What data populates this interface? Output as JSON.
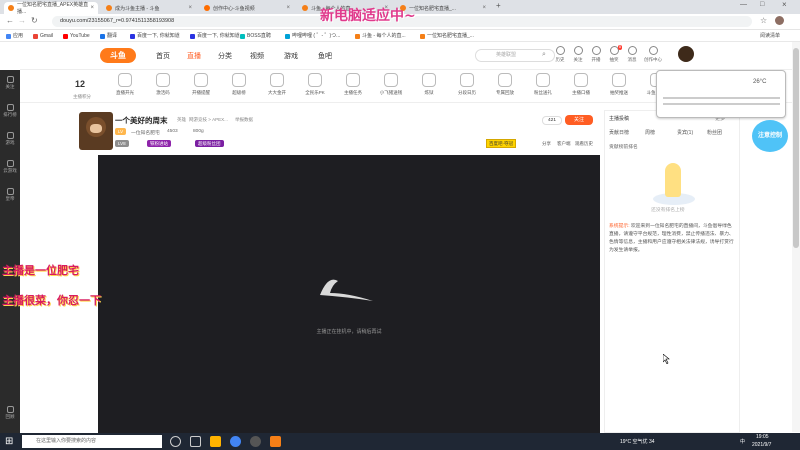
{
  "browser": {
    "tabs": [
      {
        "label": "一位知名肥宅直播_APEX英雄直播..."
      },
      {
        "label": "成为斗鱼主播 - 斗鱼"
      },
      {
        "label": "创作中心-斗鱼视频"
      },
      {
        "label": "斗鱼 - 每个人的直..."
      },
      {
        "label": "一位知名肥宅直播_..."
      }
    ],
    "url": "douyu.com/23155067_r=0.9741511358193908",
    "bookmarks": [
      "应用",
      "Gmail",
      "YouTube",
      "翻译",
      "百度一下, 你就知道",
      "百度一下, 你就知道",
      "BOSS直聘",
      "哔哩哔哩 ( ゜- ゜)つ...",
      "斗鱼 - 每个人的直...",
      "一位知名肥宅直播_..."
    ],
    "reading_list": "阅读清单"
  },
  "overlay_banner": "新电脑适应中~",
  "overlay_line1": "主播是一位肥宅",
  "overlay_line2": "主播很菜，你忍一下",
  "site": {
    "logo": "斗鱼",
    "nav": [
      "首页",
      "直播",
      "分类",
      "视频",
      "游戏",
      "鱼吧"
    ],
    "nav_active": "直播",
    "search_placeholder": "英雄联盟",
    "header_icons": [
      {
        "label": "历史",
        "name": "history-icon"
      },
      {
        "label": "关注",
        "name": "follow-icon"
      },
      {
        "label": "开播",
        "name": "broadcast-icon"
      },
      {
        "label": "抽奖",
        "name": "lottery-icon"
      },
      {
        "label": "消息",
        "name": "message-icon"
      },
      {
        "label": "创作中心",
        "name": "creator-icon"
      }
    ]
  },
  "sidebar": [
    {
      "label": "关注",
      "name": "follow-icon"
    },
    {
      "label": "排行榜",
      "name": "rank-icon"
    },
    {
      "label": "游戏",
      "name": "game-icon"
    },
    {
      "label": "云游戏",
      "name": "cloud-game-icon"
    },
    {
      "label": "皇帝",
      "name": "crown-icon"
    },
    {
      "label": "回顾",
      "name": "review-icon"
    }
  ],
  "toolbar": {
    "level": "12",
    "level_label": "主播积分",
    "items": [
      "直播开光",
      "激活码",
      "开播提醒",
      "超级榜",
      "大大金开",
      "全民乐PK",
      "主播任务",
      "小飞猪送钱",
      "炼狱",
      "分段日历",
      "专属回放",
      "粉丝送礼",
      "主播口播",
      "抽奖推送",
      "斗鱼BUFF"
    ]
  },
  "streamer": {
    "title": "一个美好的周末",
    "category": "英雄",
    "game": "网游竞技 > APEX...",
    "report": "举报数据",
    "name": "一位知名肥宅",
    "hot": "4503",
    "fans": "800g",
    "badge_lv": "LV8",
    "tag1": "铁粉进站",
    "tag2": "超级粉丝团",
    "follow_count": "421",
    "follow_btn": "关注",
    "share": "分享",
    "client": "客户端",
    "more": "观看历史",
    "yellow_badge": "百度吧·夺冠"
  },
  "video": {
    "message": "主播正在挂机中，请稍后再试"
  },
  "right_panel": {
    "header": "主播投稿",
    "more": "更多",
    "tabs": [
      "贡献日榜",
      "周榜",
      "贵宾(1)",
      "粉丝团"
    ],
    "leaderboard_label": "贡献榜前排名",
    "empty_text": "还没有排名上榜",
    "notice_title": "系统提示:",
    "notice": "欢迎来到一位知名肥宅的直播间，斗鱼倡导绿色直播，请遵守平台规范，理性消费，禁止传播违法、暴力、色情等信息，主播和用户应遵守相关法律法规，诱导打赏行为发生请举报。",
    "ac_temp": "26°C",
    "sticker": "注意控制"
  },
  "taskbar": {
    "search_placeholder": "在这里输入你要搜索的内容",
    "weather": "19°C 空气优 34",
    "time": "19:05",
    "date": "2021/9/7",
    "lang": "中"
  },
  "colors": {
    "accent": "#ff5d23",
    "video_bg": "#1e1e22",
    "overlay_text": "#e03a8c",
    "overlay_caption": "#d81b60"
  }
}
